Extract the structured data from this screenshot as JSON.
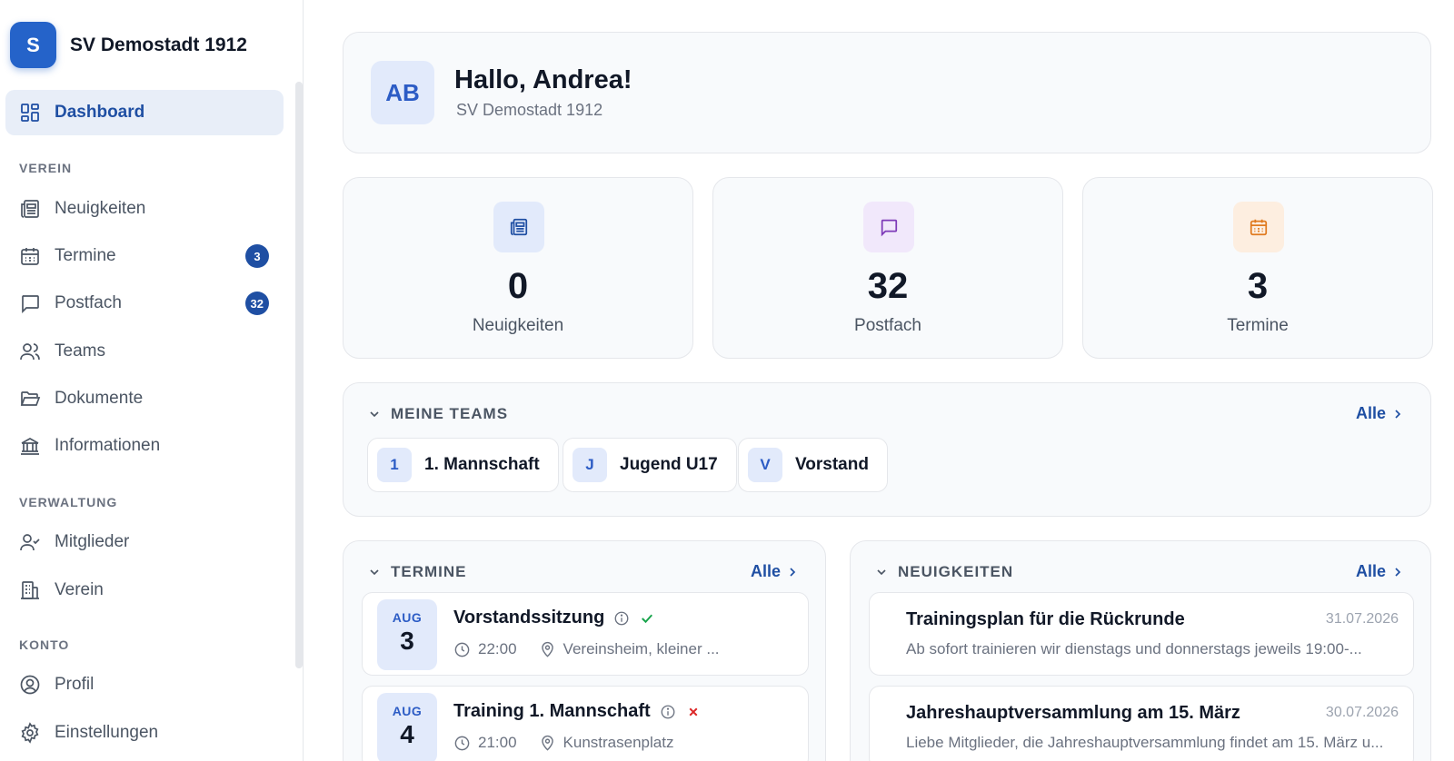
{
  "brand": {
    "logo_letter": "S",
    "name": "SV Demostadt 1912"
  },
  "sidebar": {
    "dashboard": "Dashboard",
    "sections": {
      "verein": "VEREIN",
      "verwaltung": "VERWALTUNG",
      "konto": "KONTO"
    },
    "items": {
      "neuigkeiten": "Neuigkeiten",
      "termine": "Termine",
      "termine_badge": "3",
      "postfach": "Postfach",
      "postfach_badge": "32",
      "teams": "Teams",
      "dokumente": "Dokumente",
      "informationen": "Informationen",
      "mitglieder": "Mitglieder",
      "verein": "Verein",
      "profil": "Profil",
      "einstellungen": "Einstellungen"
    }
  },
  "greeting": {
    "initials": "AB",
    "title": "Hallo, Andrea!",
    "club": "SV Demostadt 1912"
  },
  "stats": [
    {
      "value": "0",
      "label": "Neuigkeiten",
      "icon": "newspaper-icon",
      "color": "#1f4fa3",
      "bg": "#e2eafb"
    },
    {
      "value": "32",
      "label": "Postfach",
      "icon": "chat-icon",
      "color": "#7e3bb8",
      "bg": "#f1e8fb"
    },
    {
      "value": "3",
      "label": "Termine",
      "icon": "calendar-icon",
      "color": "#e07a1f",
      "bg": "#fdeee0"
    }
  ],
  "teams": {
    "title": "MEINE TEAMS",
    "all": "Alle",
    "items": [
      {
        "initial": "1",
        "name": "1. Mannschaft"
      },
      {
        "initial": "J",
        "name": "Jugend U17"
      },
      {
        "initial": "V",
        "name": "Vorstand"
      }
    ]
  },
  "termine": {
    "title": "TERMINE",
    "all": "Alle",
    "items": [
      {
        "month": "AUG",
        "day": "3",
        "title": "Vorstandssitzung",
        "time": "22:00",
        "location": "Vereinsheim, kleiner ...",
        "status": "check"
      },
      {
        "month": "AUG",
        "day": "4",
        "title": "Training 1. Mannschaft",
        "time": "21:00",
        "location": "Kunstrasenplatz",
        "status": "cross"
      }
    ]
  },
  "news": {
    "title": "NEUIGKEITEN",
    "all": "Alle",
    "items": [
      {
        "title": "Trainingsplan für die Rückrunde",
        "date": "31.07.2026",
        "excerpt": "Ab sofort trainieren wir dienstags und donnerstags jeweils 19:00-..."
      },
      {
        "title": "Jahreshauptversammlung am 15. März",
        "date": "30.07.2026",
        "excerpt": "Liebe Mitglieder, die Jahreshauptversammlung findet am 15. März u..."
      }
    ]
  },
  "colors": {
    "primary": "#1f4fa3",
    "logo": "#2563c9",
    "success": "#16a34a",
    "danger": "#dc2626"
  }
}
